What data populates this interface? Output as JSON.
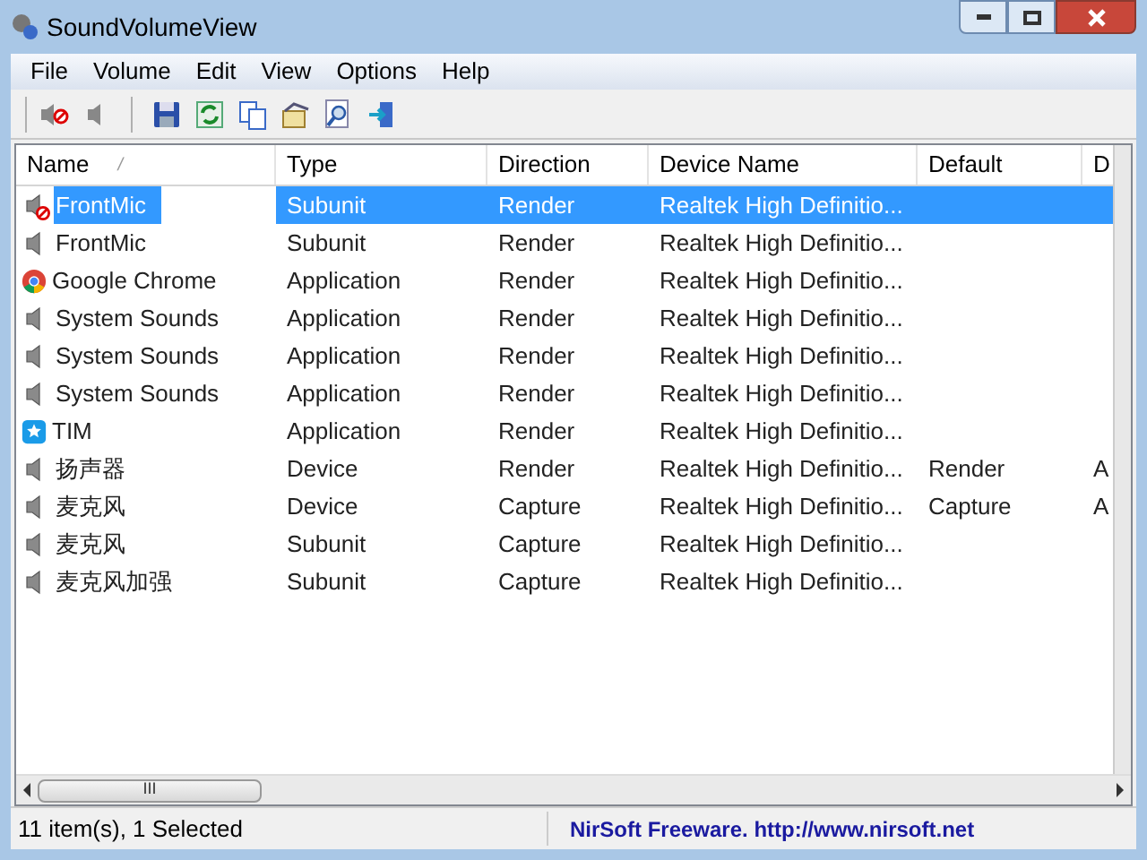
{
  "window": {
    "title": "SoundVolumeView"
  },
  "menu": [
    "File",
    "Volume",
    "Edit",
    "View",
    "Options",
    "Help"
  ],
  "toolbar": [
    {
      "kind": "mute"
    },
    {
      "kind": "unmute"
    },
    {
      "kind": "separator"
    },
    {
      "kind": "save"
    },
    {
      "kind": "refresh"
    },
    {
      "kind": "copy"
    },
    {
      "kind": "properties"
    },
    {
      "kind": "find"
    },
    {
      "kind": "exit"
    }
  ],
  "table": {
    "columns": [
      "Name",
      "Type",
      "Direction",
      "Device Name",
      "Default",
      "D"
    ],
    "sort_mark": "/",
    "rows": [
      {
        "kind": "muted",
        "selected": true,
        "cells": [
          "FrontMic",
          "Subunit",
          "Render",
          "Realtek High Definitio...",
          "",
          ""
        ]
      },
      {
        "kind": "speaker",
        "selected": false,
        "cells": [
          "FrontMic",
          "Subunit",
          "Render",
          "Realtek High Definitio...",
          "",
          ""
        ]
      },
      {
        "kind": "chrome",
        "selected": false,
        "cells": [
          "Google Chrome",
          "Application",
          "Render",
          "Realtek High Definitio...",
          "",
          ""
        ]
      },
      {
        "kind": "speaker",
        "selected": false,
        "cells": [
          "System Sounds",
          "Application",
          "Render",
          "Realtek High Definitio...",
          "",
          ""
        ]
      },
      {
        "kind": "speaker",
        "selected": false,
        "cells": [
          "System Sounds",
          "Application",
          "Render",
          "Realtek High Definitio...",
          "",
          ""
        ]
      },
      {
        "kind": "speaker",
        "selected": false,
        "cells": [
          "System Sounds",
          "Application",
          "Render",
          "Realtek High Definitio...",
          "",
          ""
        ]
      },
      {
        "kind": "tim",
        "selected": false,
        "cells": [
          "TIM",
          "Application",
          "Render",
          "Realtek High Definitio...",
          "",
          ""
        ]
      },
      {
        "kind": "speaker",
        "selected": false,
        "cells": [
          "扬声器",
          "Device",
          "Render",
          "Realtek High Definitio...",
          "Render",
          "A"
        ]
      },
      {
        "kind": "speaker",
        "selected": false,
        "cells": [
          "麦克风",
          "Device",
          "Capture",
          "Realtek High Definitio...",
          "Capture",
          "A"
        ]
      },
      {
        "kind": "speaker",
        "selected": false,
        "cells": [
          "麦克风",
          "Subunit",
          "Capture",
          "Realtek High Definitio...",
          "",
          ""
        ]
      },
      {
        "kind": "speaker",
        "selected": false,
        "cells": [
          "麦克风加强",
          "Subunit",
          "Capture",
          "Realtek High Definitio...",
          "",
          ""
        ]
      }
    ]
  },
  "scrollbar": {
    "grip": "III"
  },
  "status_bar": {
    "count": "11 item(s), 1 Selected",
    "credit": "NirSoft Freeware.  http://www.nirsoft.net"
  }
}
